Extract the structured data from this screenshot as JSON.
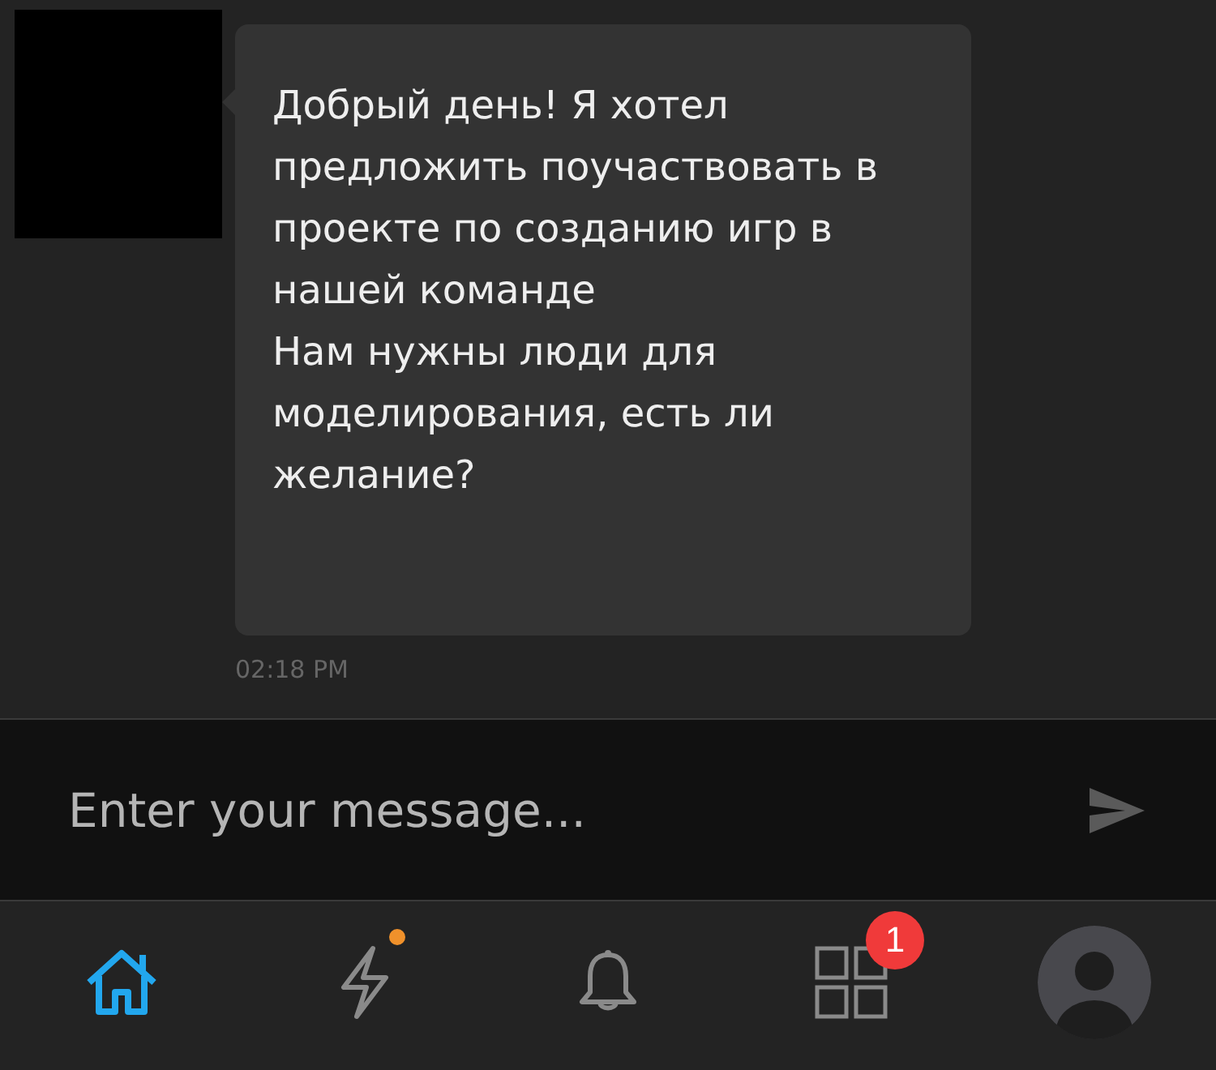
{
  "message": {
    "text": "Добрый день! Я хотел предложить поучаствовать в проекте по созданию игр в нашей команде\nНам нужны люди для моделирования, есть ли желание?",
    "time": "02:18 PM"
  },
  "composer": {
    "placeholder": "Enter your message..."
  },
  "nav": [
    {
      "kind": "home",
      "selected": true,
      "dot": false
    },
    {
      "kind": "activity",
      "selected": false,
      "dot": true
    },
    {
      "kind": "notifications",
      "selected": false,
      "dot": false
    },
    {
      "kind": "apps",
      "selected": false,
      "dot": false,
      "badge": "1"
    },
    {
      "kind": "profile",
      "selected": false,
      "dot": false
    }
  ]
}
